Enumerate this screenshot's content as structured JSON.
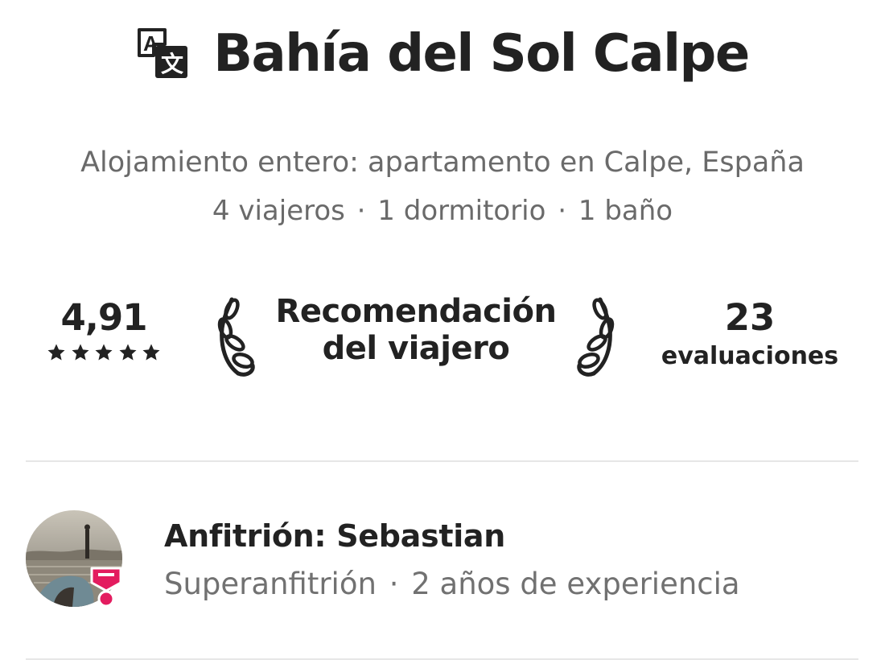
{
  "listing": {
    "title": "Bahía del Sol Calpe",
    "type_location": "Alojamiento entero: apartamento en Calpe, España",
    "guests": "4 viajeros",
    "bedrooms": "1 dormitorio",
    "baths": "1 baño",
    "separator": "·"
  },
  "stats": {
    "rating": "4,91",
    "stars": 5,
    "award_line1": "Recomendación",
    "award_line2": "del viajero",
    "reviews_count": "23",
    "reviews_label": "evaluaciones"
  },
  "host": {
    "name_line": "Anfitrión: Sebastian",
    "status": "Superanfitrión",
    "experience": "2 años de experiencia",
    "separator": "·"
  },
  "icons": {
    "translate": "translate-icon",
    "star": "star-icon",
    "laurel": "laurel-icon",
    "superhost": "superhost-badge-icon"
  },
  "colors": {
    "text": "#222222",
    "muted": "#717171",
    "brand": "#E31C5F",
    "divider": "#e6e6e6"
  }
}
